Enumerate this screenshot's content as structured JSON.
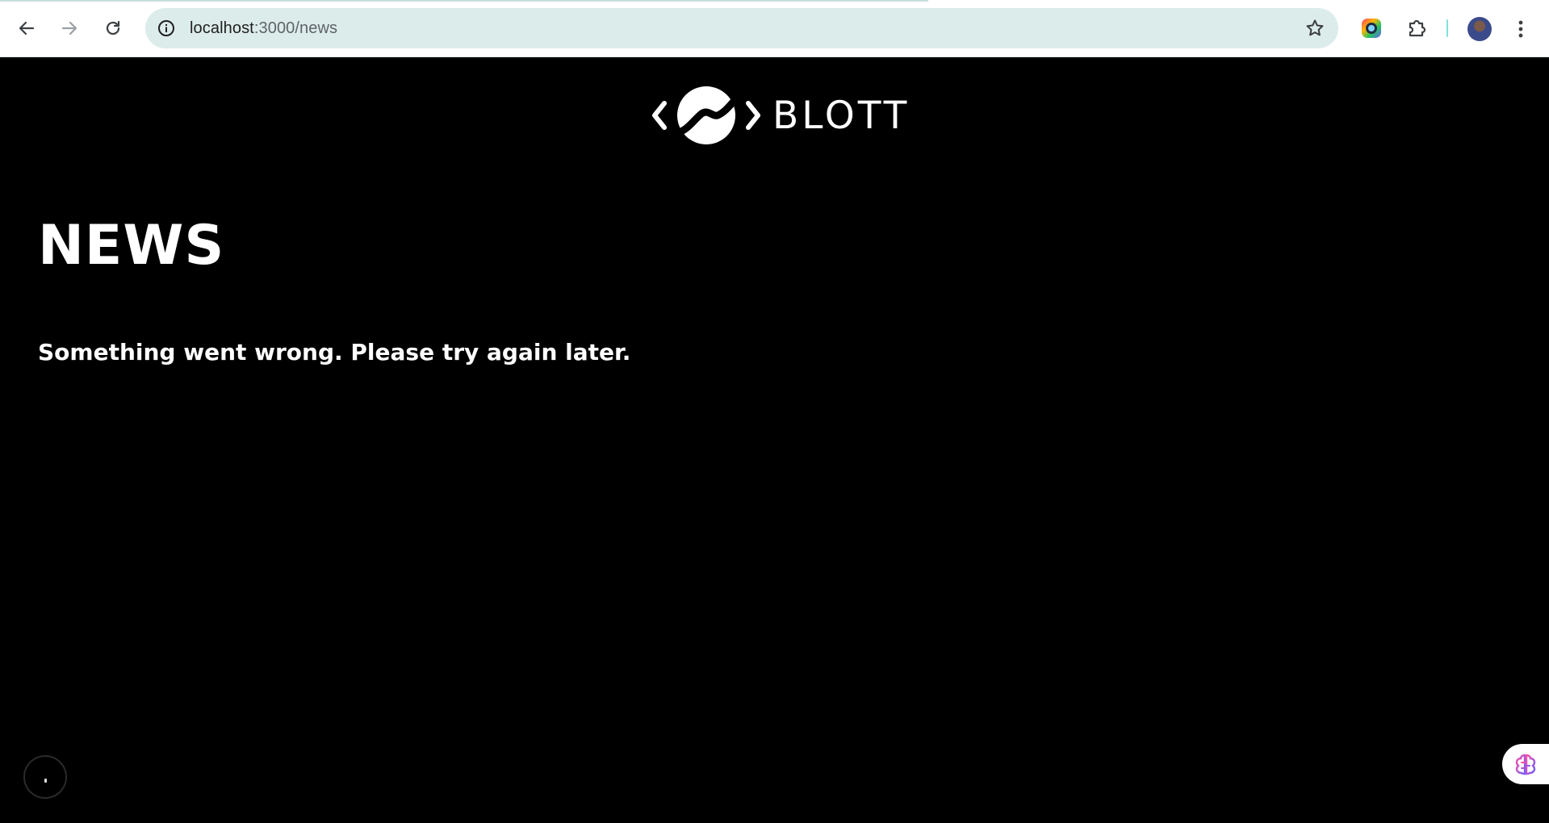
{
  "browser": {
    "url_host": "localhost",
    "url_path": ":3000/news",
    "icons": {
      "back": "arrow-left-icon",
      "forward": "arrow-right-icon",
      "reload": "reload-icon",
      "site_info": "info-icon",
      "bookmark": "star-icon",
      "extension_1": "color-wheel-icon",
      "extensions": "puzzle-icon",
      "profile": "avatar",
      "menu": "kebab-menu-icon"
    }
  },
  "page": {
    "logo_text": "BLOTT",
    "title": "NEWS",
    "error_message": "Something went wrong. Please try again later."
  },
  "colors": {
    "page_background": "#000000",
    "text": "#ffffff",
    "omnibox": "#dceceb",
    "accent": "#7fe3d6"
  }
}
